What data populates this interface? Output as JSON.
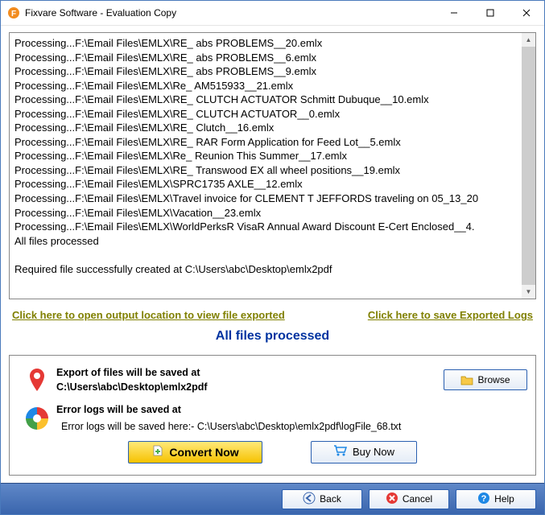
{
  "window": {
    "title": "Fixvare Software - Evaluation Copy"
  },
  "log": {
    "lines": [
      "Processing...F:\\Email Files\\EMLX\\RE_ abs PROBLEMS__20.emlx",
      "Processing...F:\\Email Files\\EMLX\\RE_ abs PROBLEMS__6.emlx",
      "Processing...F:\\Email Files\\EMLX\\RE_ abs PROBLEMS__9.emlx",
      "Processing...F:\\Email Files\\EMLX\\Re_ AM515933__21.emlx",
      "Processing...F:\\Email Files\\EMLX\\RE_ CLUTCH ACTUATOR Schmitt Dubuque__10.emlx",
      "Processing...F:\\Email Files\\EMLX\\RE_ CLUTCH ACTUATOR__0.emlx",
      "Processing...F:\\Email Files\\EMLX\\RE_ Clutch__16.emlx",
      "Processing...F:\\Email Files\\EMLX\\RE_ RAR Form Application for Feed Lot__5.emlx",
      "Processing...F:\\Email Files\\EMLX\\Re_ Reunion This Summer__17.emlx",
      "Processing...F:\\Email Files\\EMLX\\RE_ Transwood EX all wheel positions__19.emlx",
      "Processing...F:\\Email Files\\EMLX\\SPRC1735 AXLE__12.emlx",
      "Processing...F:\\Email Files\\EMLX\\Travel invoice for CLEMENT T JEFFORDS traveling on 05_13_20",
      "Processing...F:\\Email Files\\EMLX\\Vacation__23.emlx",
      "Processing...F:\\Email Files\\EMLX\\WorldPerksR VisaR Annual Award Discount E-Cert Enclosed__4.",
      "All files processed",
      "",
      "Required file successfully created at C:\\Users\\abc\\Desktop\\emlx2pdf"
    ]
  },
  "links": {
    "open_output": "Click here to open output location to view file exported",
    "save_logs": "Click here to save Exported Logs"
  },
  "status": "All files processed",
  "panel": {
    "export_label": "Export of files will be saved at",
    "export_path": "C:\\Users\\abc\\Desktop\\emlx2pdf",
    "browse_label": "Browse",
    "errlog_label": "Error logs will be saved at",
    "errlog_path": "Error logs will be saved here:- C:\\Users\\abc\\Desktop\\emlx2pdf\\logFile_68.txt"
  },
  "actions": {
    "convert": "Convert Now",
    "buy": "Buy Now"
  },
  "footer": {
    "back": "Back",
    "cancel": "Cancel",
    "help": "Help"
  }
}
